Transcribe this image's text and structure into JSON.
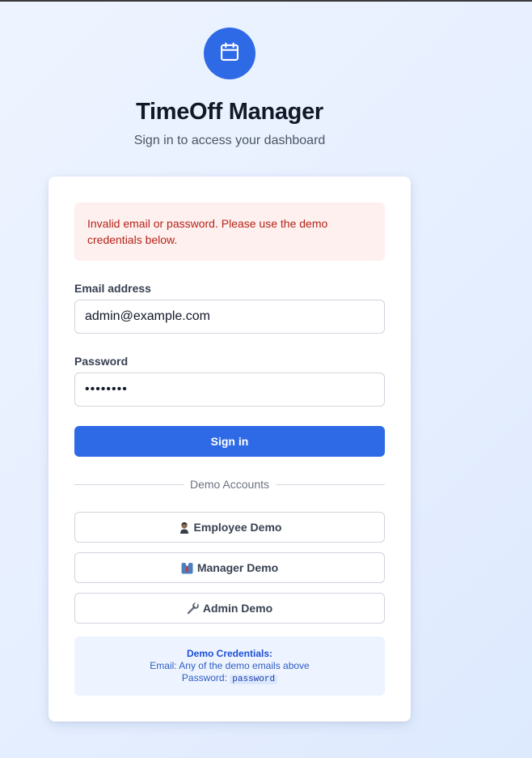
{
  "app": {
    "title": "TimeOff Manager",
    "subtitle": "Sign in to access your dashboard",
    "logo_icon": "calendar-icon",
    "brand_color": "#2f6ae6"
  },
  "alert": {
    "message": "Invalid email or password. Please use the demo credentials below.",
    "color": "#b42318"
  },
  "form": {
    "email_label": "Email address",
    "email_value": "admin@example.com",
    "password_label": "Password",
    "password_value": "••••••••",
    "submit_label": "Sign in"
  },
  "demo": {
    "divider_label": "Demo Accounts",
    "buttons": [
      {
        "label": "Employee Demo",
        "icon": "person-icon"
      },
      {
        "label": "Manager Demo",
        "icon": "suit-icon"
      },
      {
        "label": "Admin Demo",
        "icon": "wrench-icon"
      }
    ]
  },
  "credentials": {
    "heading": "Demo Credentials:",
    "email_line": "Email: Any of the demo emails above",
    "password_prefix": "Password:",
    "password_code": "password"
  }
}
